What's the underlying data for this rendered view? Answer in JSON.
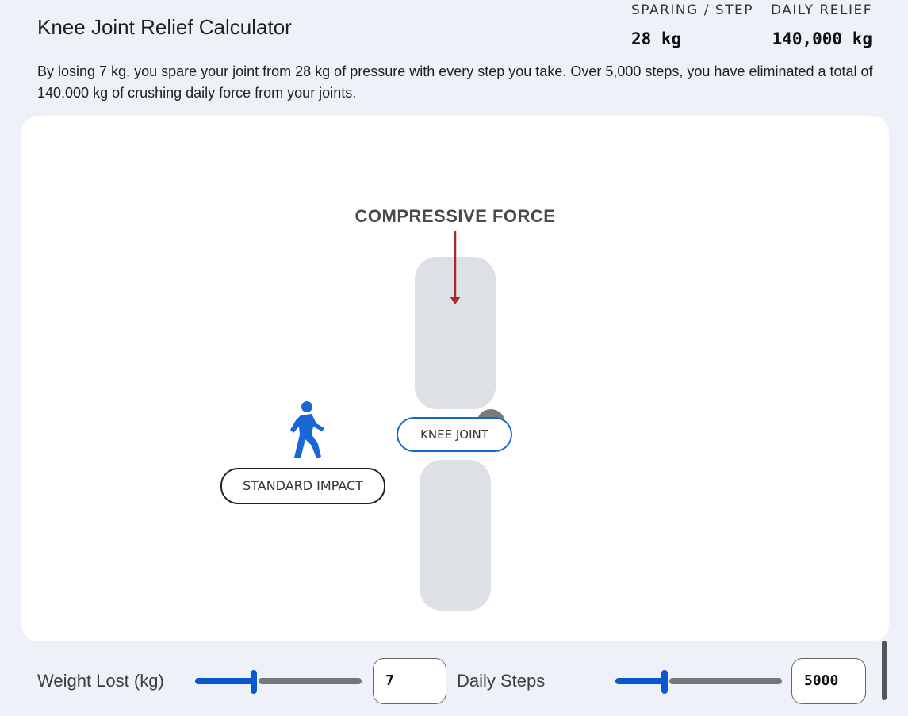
{
  "header": {
    "title": "Knee Joint Relief Calculator",
    "sparing_label": "SPARING / STEP",
    "sparing_value": "28 kg",
    "relief_label": "DAILY RELIEF",
    "relief_value": "140,000 kg"
  },
  "description": "By losing 7 kg, you spare your joint from 28 kg of pressure with every step you take. Over 5,000 steps, you have eliminated a total of 140,000 kg of crushing daily force from your joints.",
  "diagram": {
    "force_label": "COMPRESSIVE FORCE",
    "knee_label": "KNEE JOINT",
    "impact_label": "STANDARD IMPACT",
    "walker_icon": "walking-person-icon",
    "arrow_color": "#a52a2a",
    "bone_color": "#dde0e4"
  },
  "controls": {
    "weight_label": "Weight Lost (kg)",
    "weight_value": "7",
    "weight_fraction": 0.35,
    "steps_label": "Daily Steps",
    "steps_value": "5000",
    "steps_fraction": 0.3
  },
  "colors": {
    "accent": "#0b57d0",
    "background": "#eef2f8"
  }
}
